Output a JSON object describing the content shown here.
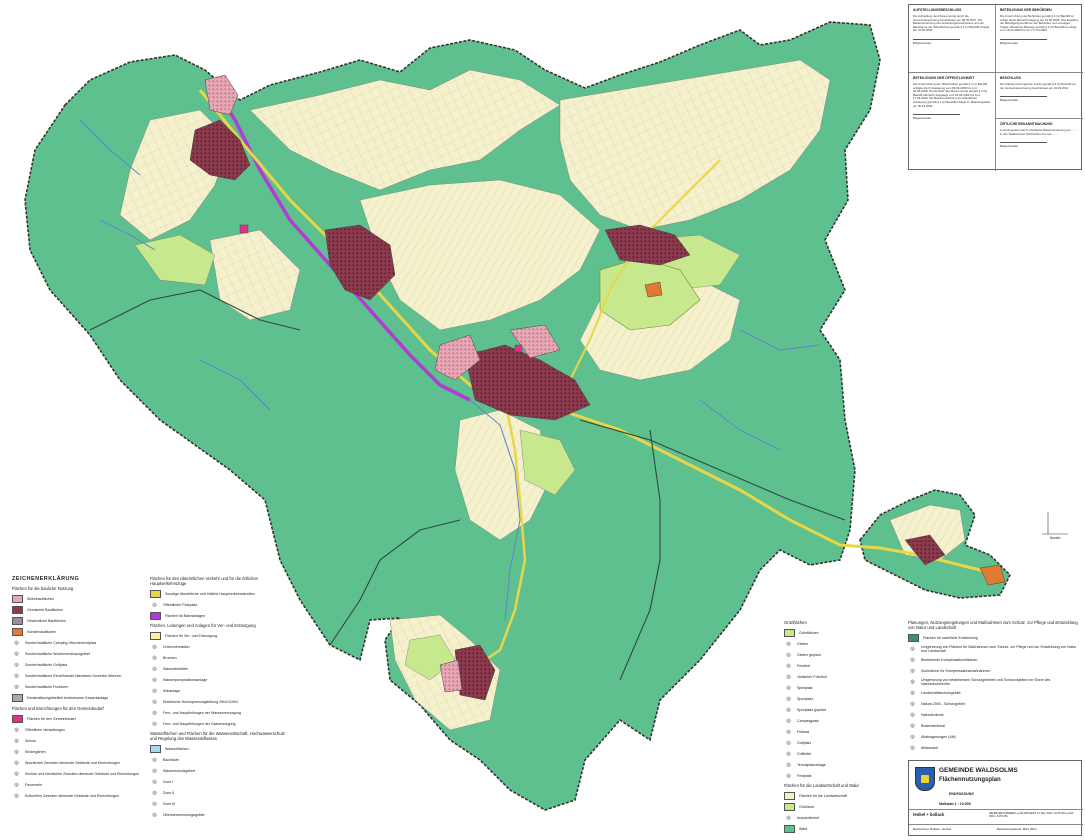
{
  "colors": {
    "forest": "#5ec08e",
    "agri": "#f5f1cc",
    "grass": "#c7e88c",
    "village": "#8a3b4e",
    "village_light": "#e7a7b5",
    "road": "#e8d64a",
    "purple": "#b13bd4",
    "water": "#5e84c8",
    "boundary": "#3a3a3a"
  },
  "legend_left": {
    "title": "ZEICHENERKLÄRUNG",
    "section1": "Flächen für die bauliche Nutzung",
    "items1": [
      {
        "label": "Wohnbauflächen",
        "color": "#e7a7b5"
      },
      {
        "label": "Gemischte Bauflächen",
        "color": "#8a3b4e"
      },
      {
        "label": "Gewerbliche Bauflächen",
        "color": "#9b8aa4"
      },
      {
        "label": "Sonderbauflächen",
        "color": "#e07a33"
      },
      {
        "label": "Sonderbaufläche Camping-/Wochenendplatz",
        "color": ""
      },
      {
        "label": "Sonderbaufläche Wochenendhausgebiet",
        "color": ""
      },
      {
        "label": "Sonderbaufläche Golfplatz",
        "color": ""
      },
      {
        "label": "Sonderbaufläche Einzelhandel-Handwerk-Gewerbe-Wohnen",
        "color": ""
      },
      {
        "label": "Sonderbaufläche Funkturm",
        "color": ""
      },
      {
        "label": "Denkmalfachgebietlich bedeutsame Gesamtanlage",
        "color": "#aaaaaa"
      }
    ],
    "section2": "Flächen und Einrichtungen für den Gemeinbedarf",
    "items2": [
      {
        "label": "Flächen für den Gemeinbedarf",
        "color": "#e0308a"
      },
      {
        "label": "Öffentliche Verwaltungen"
      },
      {
        "label": "Schule"
      },
      {
        "label": "Kindergärten"
      },
      {
        "label": "Sportlichen Zwecken dienende Gebäude und Einrichtungen"
      },
      {
        "label": "Kirchen und kirchlichen Zwecken dienende Gebäude und Einrichtungen"
      },
      {
        "label": "Feuerwehr"
      },
      {
        "label": "Kulturellen Zwecken dienende Gebäude und Einrichtungen"
      }
    ]
  },
  "legend_mid": {
    "section1": "Flächen für den überörtlichen Verkehr und für die örtlichen Hauptverkehrszüge",
    "items1": [
      {
        "label": "Sonstige überörtliche und örtliche Hauptverkehrsstraßen",
        "color": "#e8d64a"
      },
      {
        "label": "Öffentlicher Parkplatz",
        "color": ""
      },
      {
        "label": "Flächen für Bahnanlagen",
        "color": "#b13bd4"
      }
    ],
    "section2": "Flächen, Leitungen und Anlagen für Ver- und Entsorgung",
    "items2": [
      {
        "label": "Flächen für Ver- und Entsorgung",
        "color": "#f5f1a0"
      },
      {
        "label": "Umformerstation"
      },
      {
        "label": "Brunnen"
      },
      {
        "label": "Wasserbehälter"
      },
      {
        "label": "Wasserpumpstationsanlage"
      },
      {
        "label": "Kläranlage"
      },
      {
        "label": "Elektrische Hochspannungsleitung 20kV/110kV"
      },
      {
        "label": "Fern- und Hauptleitungen der Wasserversorgung"
      },
      {
        "label": "Fern- und Hauptleitungen der Gasversorgung"
      }
    ],
    "section3": "Wasserflächen und Flächen für die Wasserwirtschaft, Hochwasserschutz und Regelung des Wasserabflusses",
    "items3": [
      {
        "label": "Wasserflächen",
        "color": "#a8d8ee"
      },
      {
        "label": "Bachläufe"
      },
      {
        "label": "Wasserschutzgebiet"
      },
      {
        "label": "Zone I"
      },
      {
        "label": "Zone II"
      },
      {
        "label": "Zone III"
      },
      {
        "label": "Überschwemmungsgebiet"
      }
    ]
  },
  "legend_green": {
    "section": "Grünflächen",
    "items": [
      {
        "label": "Grünflächen",
        "color": "#c7e88c"
      },
      {
        "label": "Gärten"
      },
      {
        "label": "Gärten geplant"
      },
      {
        "label": "Friedhof"
      },
      {
        "label": "Jüdischer Friedhof"
      },
      {
        "label": "Spielplatz"
      },
      {
        "label": "Sportplatz"
      },
      {
        "label": "Sportplatz geplant"
      },
      {
        "label": "Campingplatz"
      },
      {
        "label": "Freibad"
      },
      {
        "label": "Golfplatz"
      },
      {
        "label": "Grillhütte"
      },
      {
        "label": "Tennisplatzanlage"
      },
      {
        "label": "Festplatz"
      }
    ],
    "section2": "Flächen für die Landwirtschaft und Wald",
    "items2": [
      {
        "label": "Flächen für die Landwirtschaft",
        "color": "#f5f1cc"
      },
      {
        "label": "Grünland",
        "color": "#c7e88c"
      },
      {
        "label": "Aussiedlerhof"
      },
      {
        "label": "Wald",
        "color": "#5ec08e"
      }
    ]
  },
  "legend_right": {
    "section": "Planungen, Nutzungsregelungen und Maßnahmen zum Schutz, zur Pflege und Entwicklung von Natur und Landschaft",
    "items": [
      {
        "label": "Flächen für natürliche Entwicklung",
        "color": "#3d8f6a"
      },
      {
        "label": "Umgrenzung von Flächen für Maßnahmen zum Schutz, zur Pflege und zur Entwicklung von Natur und Landschaft"
      },
      {
        "label": "Bestehende Kompensationsflächen"
      },
      {
        "label": "Suchräume für Kompensationsmaßnahmen"
      },
      {
        "label": "Umgrenzung von bestehenden Schutzgebieten und Schutzobjekten im Sinne des Naturschutzrechts"
      },
      {
        "label": "Landschaftsschutzgebiet"
      },
      {
        "label": "Natura 2000 - Schutzgebiet"
      },
      {
        "label": "Naturdenkmal"
      },
      {
        "label": "Bodendenkmal"
      },
      {
        "label": "Altablagerungen (Altl)"
      },
      {
        "label": "Altstandort"
      }
    ]
  },
  "titleblock": {
    "municipality": "GEMEINDE WALDSOLMS",
    "plan": "Flächennutzungsplan",
    "phase": "ENDFASSUNG",
    "scale": "Maßstab 1 : 10.000",
    "firm": "tenkel + bollack",
    "address": "DELBE WETTENBERG  ●  AM WINGERT 21  TEL: 0641 / 4279 294  ●  FAX: 0641 / 4279 451",
    "status": "Bearbeitungsstand: März 2010",
    "editor": "Bearbeitung:  Bollack - Henkel"
  },
  "procedure": {
    "cells": [
      {
        "title": "AUFSTELLUNGSBESCHLUSS",
        "text": "Die Aufstellung des Planes wurde durch die Gemeindevertretung beschlossen am 08.05.2007. Die Bekanntmachung des Aufstellungsbeschlusses und der Beteiligung der Öffentlichkeit gemäß § 3 (1) BauGB erfolgte am 21.06.2008.",
        "sig": "Bürgermeister"
      },
      {
        "title": "BETEILIGUNG DER BEHÖRDEN",
        "text": "Die Unterrichtung der Behörden gemäß § 4 (1) BauGB ist erfolgt durch Benachrichtigung am 19.05.2008. Das Ergebnis der Beteiligungsverfahren der Behörden und sonstigen Träger öffentlicher Belange gemäß § 4 (2) BauGB ist erfolgt vom 18.03.2009 bis zum 17.04.2009.",
        "sig": "Bürgermeister"
      },
      {
        "title": "BETEILIGUNG DER ÖFFENTLICHKEIT",
        "text": "Die Unterrichtung der Öffentlichkeit gemäß § 3 (1) BauGB erfolgte durch Auslegung vom 09.06.2008 bis zum 20.06.2008. Der Entwurf des Planes wurde gemäß § 3 (2) BauGB öffentlich ausgelegt vom 18.03.2009 bis zum 17.04.2009. Die Bekanntmachung der öffentlichen Auslegung gemäß § 3 (2) BauGB erfolgte im Mitteilungsblatt am 05.03.2009.",
        "sig": "Bürgermeister"
      },
      {
        "title": "BESCHLUSS",
        "text": "Der Flächennutzungsplan wurde gemäß § 6 (6) BauGB von der Gemeindevertretung beschlossen am 24.03.2010.",
        "sig": "Bürgermeister"
      },
      {
        "title": "ÖRTLICHE BEKANNTMACHUNG",
        "text": "In Kraft gesetzt durch ortsübliche Bekanntmachung am ........ in den Waldsolmser Nachrichten für vom ........",
        "sig": "Bürgermeister"
      }
    ]
  },
  "north_label": "Norden"
}
